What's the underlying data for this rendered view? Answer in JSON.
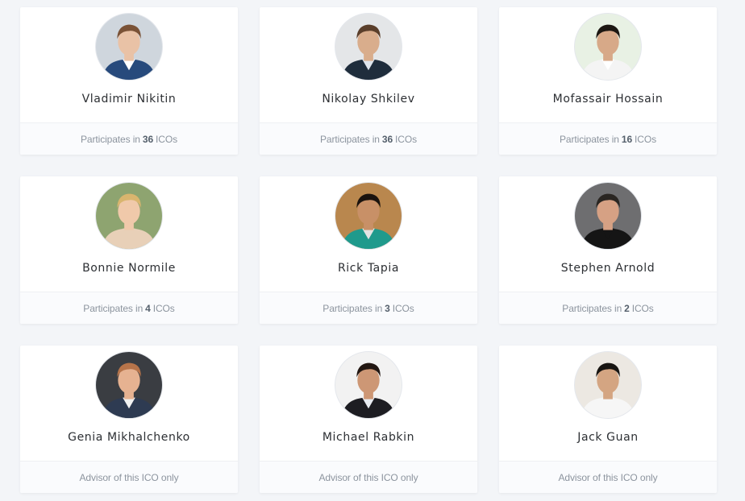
{
  "cards": [
    {
      "name": "Vladimir Nikitin",
      "prefix": "Participates in",
      "count": "36",
      "suffix": "ICOs",
      "footer": "",
      "avatar_bg": "#cfd6dd",
      "skin": "#e9c2a6",
      "hair": "#7a5236",
      "suit": "#274a7c",
      "shirt": "#ffffff"
    },
    {
      "name": "Nikolay Shkilev",
      "prefix": "Participates in",
      "count": "36",
      "suffix": "ICOs",
      "footer": "",
      "avatar_bg": "#e4e6e8",
      "skin": "#d9ad8c",
      "hair": "#5a3e2a",
      "suit": "#1f2d3c",
      "shirt": "#dfe5ec"
    },
    {
      "name": "Mofassair Hossain",
      "prefix": "Participates in",
      "count": "16",
      "suffix": "ICOs",
      "footer": "",
      "avatar_bg": "#e8f1e4",
      "skin": "#d7a988",
      "hair": "#1c1712",
      "suit": "#f4f4f4",
      "shirt": "#ffffff"
    },
    {
      "name": "Bonnie Normile",
      "prefix": "Participates in",
      "count": "4",
      "suffix": "ICOs",
      "footer": "",
      "avatar_bg": "#8ea470",
      "skin": "#f0c9aa",
      "hair": "#d9b56e",
      "suit": "#e8d0b8",
      "shirt": "#e8d0b8"
    },
    {
      "name": "Rick Tapia",
      "prefix": "Participates in",
      "count": "3",
      "suffix": "ICOs",
      "footer": "",
      "avatar_bg": "#b9874e",
      "skin": "#c89067",
      "hair": "#1b130e",
      "suit": "#1f9a8c",
      "shirt": "#e3e3e3"
    },
    {
      "name": "Stephen Arnold",
      "prefix": "Participates in",
      "count": "2",
      "suffix": "ICOs",
      "footer": "",
      "avatar_bg": "#6e6e70",
      "skin": "#d6a184",
      "hair": "#2a2622",
      "suit": "#151515",
      "shirt": "#151515"
    },
    {
      "name": "Genia Mikhalchenko",
      "prefix": "",
      "count": "",
      "suffix": "",
      "footer": "Advisor of this ICO only",
      "avatar_bg": "#3a3d42",
      "skin": "#e6b291",
      "hair": "#b7744a",
      "suit": "#2e3b52",
      "shirt": "#f2f2f2"
    },
    {
      "name": "Michael Rabkin",
      "prefix": "",
      "count": "",
      "suffix": "",
      "footer": "Advisor of this ICO only",
      "avatar_bg": "#f2f2f2",
      "skin": "#cd9775",
      "hair": "#221712",
      "suit": "#1d1d22",
      "shirt": "#e9edf2"
    },
    {
      "name": "Jack Guan",
      "prefix": "",
      "count": "",
      "suffix": "",
      "footer": "Advisor of this ICO only",
      "avatar_bg": "#ece8e2",
      "skin": "#d4a582",
      "hair": "#181512",
      "suit": "#f6f6f6",
      "shirt": "#f6f6f6"
    }
  ]
}
